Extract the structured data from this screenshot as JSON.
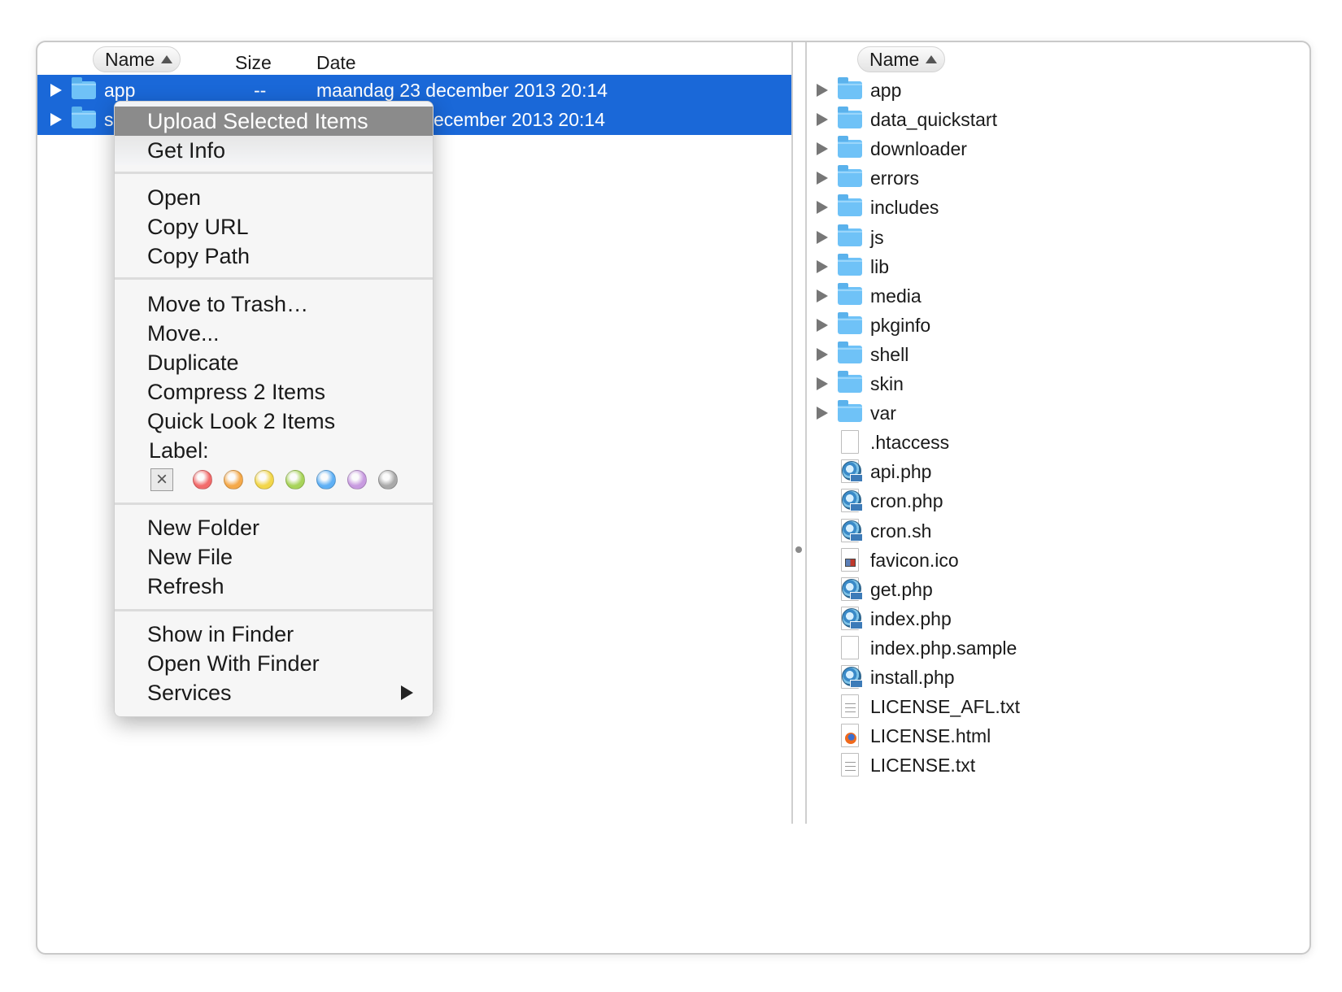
{
  "left_pane": {
    "columns": {
      "name": "Name",
      "size": "Size",
      "date": "Date"
    },
    "rows": [
      {
        "name": "app",
        "size": "--",
        "date": "maandag 23 december 2013 20:14",
        "selected": true
      },
      {
        "name": "s",
        "size": "",
        "date": "ecember 2013 20:14",
        "selected": true
      }
    ]
  },
  "right_pane": {
    "columns": {
      "name": "Name"
    },
    "rows": [
      {
        "name": "app",
        "kind": "folder"
      },
      {
        "name": "data_quickstart",
        "kind": "folder"
      },
      {
        "name": "downloader",
        "kind": "folder"
      },
      {
        "name": "errors",
        "kind": "folder"
      },
      {
        "name": "includes",
        "kind": "folder"
      },
      {
        "name": "js",
        "kind": "folder"
      },
      {
        "name": "lib",
        "kind": "folder"
      },
      {
        "name": "media",
        "kind": "folder"
      },
      {
        "name": "pkginfo",
        "kind": "folder"
      },
      {
        "name": "shell",
        "kind": "folder"
      },
      {
        "name": "skin",
        "kind": "folder"
      },
      {
        "name": "var",
        "kind": "folder"
      },
      {
        "name": ".htaccess",
        "kind": "blank-file"
      },
      {
        "name": "api.php",
        "kind": "php-file"
      },
      {
        "name": "cron.php",
        "kind": "php-file"
      },
      {
        "name": "cron.sh",
        "kind": "php-file"
      },
      {
        "name": "favicon.ico",
        "kind": "ico-file"
      },
      {
        "name": "get.php",
        "kind": "php-file"
      },
      {
        "name": "index.php",
        "kind": "php-file"
      },
      {
        "name": "index.php.sample",
        "kind": "blank-file"
      },
      {
        "name": "install.php",
        "kind": "php-file"
      },
      {
        "name": "LICENSE_AFL.txt",
        "kind": "text-file"
      },
      {
        "name": "LICENSE.html",
        "kind": "html-file"
      },
      {
        "name": "LICENSE.txt",
        "kind": "text-file"
      }
    ]
  },
  "context_menu": {
    "upload": "Upload Selected Items",
    "get_info": "Get Info",
    "open": "Open",
    "copy_url": "Copy URL",
    "copy_path": "Copy Path",
    "move_to_trash": "Move to Trash…",
    "move": "Move...",
    "duplicate": "Duplicate",
    "compress": "Compress 2 Items",
    "quick_look": "Quick Look 2 Items",
    "label_title": "Label:",
    "label_none_glyph": "×",
    "label_colors": [
      "#f26b6b",
      "#f5a94a",
      "#f2d64a",
      "#a8d45a",
      "#5fb0f5",
      "#c89be0",
      "#a9a9a9"
    ],
    "new_folder": "New Folder",
    "new_file": "New File",
    "refresh": "Refresh",
    "show_in_finder": "Show in Finder",
    "open_with_finder": "Open With Finder",
    "services": "Services"
  },
  "colors": {
    "selection": "#1a68d8",
    "menu_highlight": "#8b8b8b",
    "folder": "#6fc2f7"
  }
}
